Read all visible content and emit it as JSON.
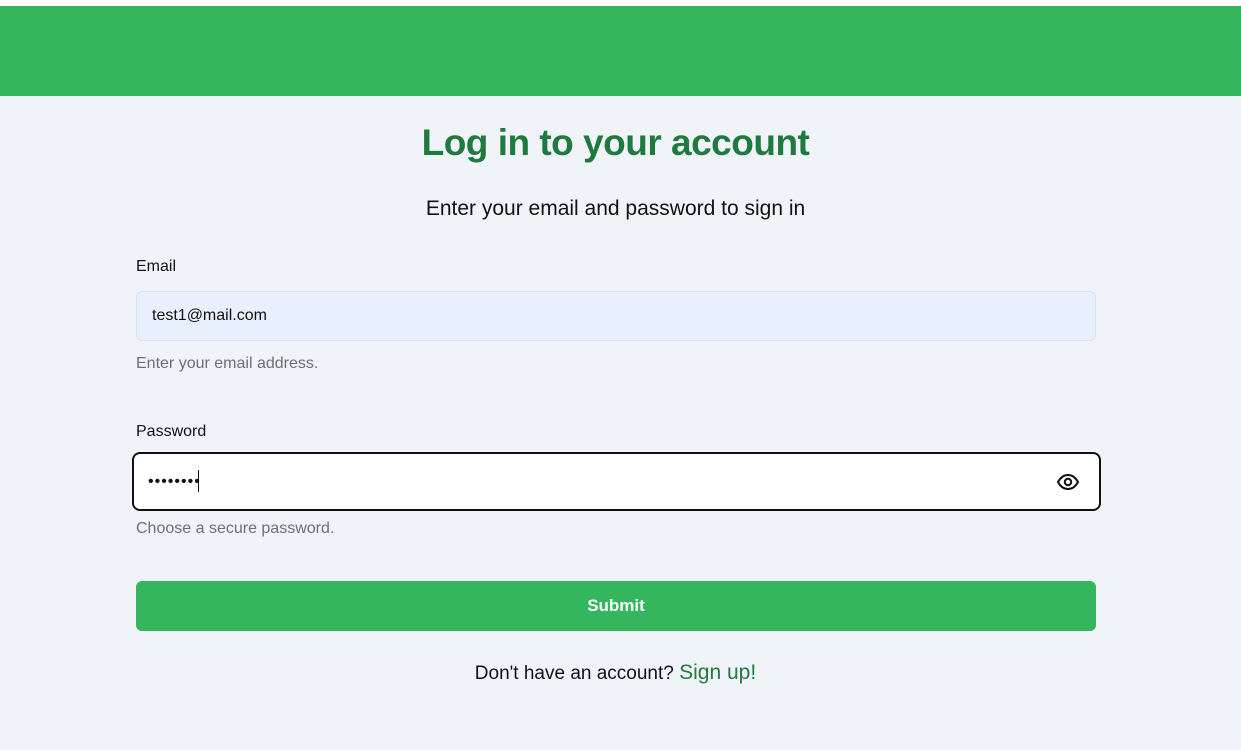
{
  "page": {
    "title": "Log in to your account",
    "subtitle": "Enter your email and password to sign in"
  },
  "form": {
    "email": {
      "label": "Email",
      "value": "test1@mail.com",
      "help": "Enter your email address."
    },
    "password": {
      "label": "Password",
      "value": "••••••••",
      "help": "Choose a secure password.",
      "toggle_icon": "eye-icon"
    },
    "submit_label": "Submit"
  },
  "footer": {
    "prompt": "Don't have an account?",
    "link_label": "Sign up!"
  },
  "colors": {
    "brand_green": "#35b55e",
    "heading_green": "#1e7a3e",
    "background": "#f0f4f8",
    "email_input_bg": "#e8f0fd"
  }
}
